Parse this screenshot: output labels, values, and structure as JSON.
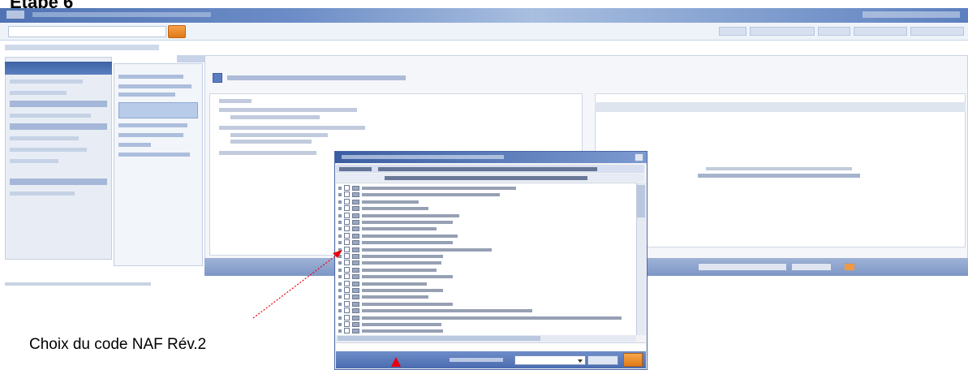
{
  "step": {
    "title": "Etape 6"
  },
  "caption": "Choix du code NAF Rév.2",
  "colors": {
    "titlebar": "#4f73b3",
    "accent_button": "#e07a18",
    "annotation": "#e8000d"
  },
  "dialog": {
    "list_items": 22,
    "pointer_row_index": 9
  }
}
